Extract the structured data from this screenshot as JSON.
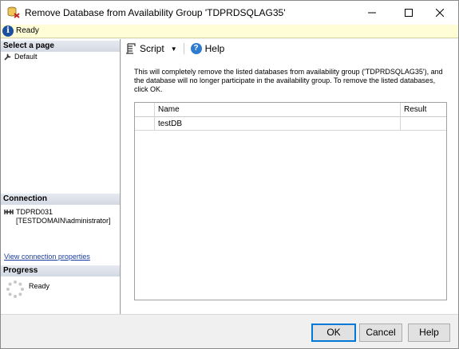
{
  "window": {
    "title": "Remove Database from Availability Group 'TDPRDSQLAG35'",
    "icon": "remove-database-icon"
  },
  "status": {
    "text": "Ready",
    "icon": "info-icon"
  },
  "left_pane": {
    "select_page_header": "Select a page",
    "pages": [
      {
        "label": "Default",
        "icon": "wrench-icon"
      }
    ],
    "connection_header": "Connection",
    "connection": {
      "server": "TDPRD031",
      "user": "[TESTDOMAIN\\administrator]",
      "icon": "server-connection-icon"
    },
    "view_connection_link": "View connection properties",
    "progress_header": "Progress",
    "progress_text": "Ready"
  },
  "toolbar": {
    "script_label": "Script",
    "help_label": "Help"
  },
  "description": "This will completely remove the listed databases from availability group ('TDPRDSQLAG35'), and the database will no longer participate in the availability group. To remove the listed databases, click OK.",
  "grid": {
    "columns": [
      "Name",
      "Result"
    ],
    "rows": [
      {
        "name": "testDB",
        "result": ""
      }
    ]
  },
  "buttons": {
    "ok": "OK",
    "cancel": "Cancel",
    "help": "Help"
  },
  "colors": {
    "status_bg": "#fefdd6",
    "link": "#1a3c9e",
    "ok_border": "#0078d7"
  }
}
